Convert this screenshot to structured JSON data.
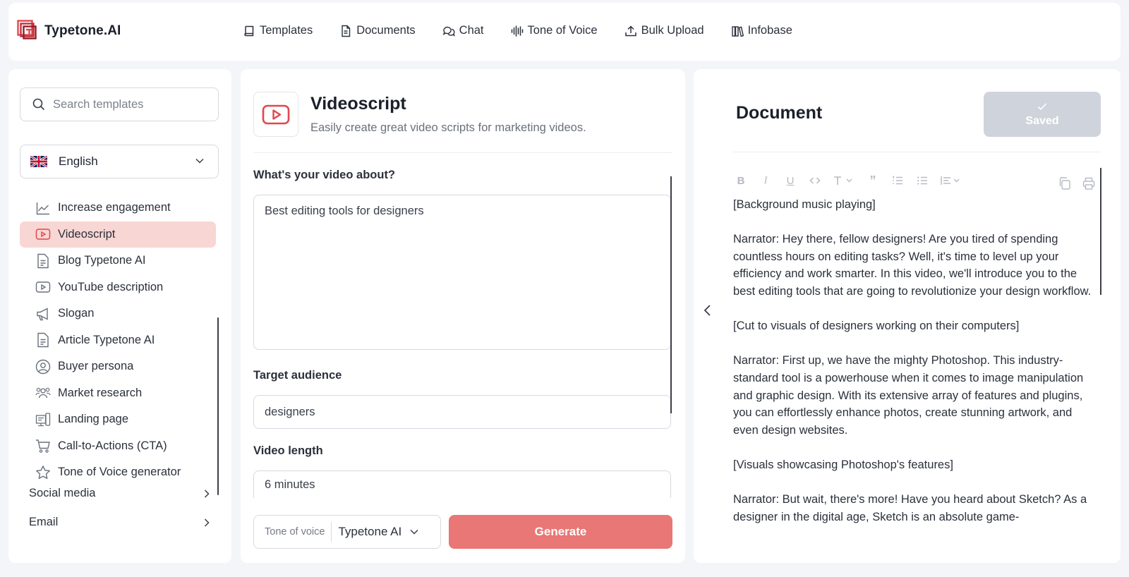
{
  "brand": {
    "name": "Typetone.AI"
  },
  "nav": [
    {
      "label": "Templates",
      "icon": "book-icon"
    },
    {
      "label": "Documents",
      "icon": "document-icon"
    },
    {
      "label": "Chat",
      "icon": "chat-icon"
    },
    {
      "label": "Tone of Voice",
      "icon": "soundwave-icon"
    },
    {
      "label": "Bulk Upload",
      "icon": "upload-icon"
    },
    {
      "label": "Infobase",
      "icon": "library-icon"
    }
  ],
  "sidebar": {
    "search_placeholder": "Search templates",
    "language": "English",
    "templates": [
      {
        "label": "Increase engagement",
        "icon": "trend-icon",
        "active": false
      },
      {
        "label": "Videoscript",
        "icon": "video-play-icon",
        "active": true
      },
      {
        "label": "Blog Typetone AI",
        "icon": "document-icon",
        "active": false
      },
      {
        "label": "YouTube description",
        "icon": "video-play-icon",
        "active": false
      },
      {
        "label": "Slogan",
        "icon": "megaphone-icon",
        "active": false
      },
      {
        "label": "Article Typetone AI",
        "icon": "document-icon",
        "active": false
      },
      {
        "label": "Buyer persona",
        "icon": "user-circle-icon",
        "active": false
      },
      {
        "label": "Market research",
        "icon": "users-icon",
        "active": false
      },
      {
        "label": "Landing page",
        "icon": "landing-page-icon",
        "active": false
      },
      {
        "label": "Call-to-Actions (CTA)",
        "icon": "cart-icon",
        "active": false
      },
      {
        "label": "Tone of Voice generator",
        "icon": "star-icon",
        "active": false
      }
    ],
    "categories": [
      {
        "label": "Social media"
      },
      {
        "label": "Email"
      }
    ]
  },
  "template": {
    "title": "Videoscript",
    "subtitle": "Easily create great video scripts for marketing videos.",
    "fields": {
      "topic_label": "What's your video about?",
      "topic_value": "Best editing tools for designers",
      "audience_label": "Target audience",
      "audience_value": "designers",
      "length_label": "Video length",
      "length_value": "6 minutes"
    },
    "tone_label": "Tone of voice",
    "tone_value": "Typetone AI",
    "generate_label": "Generate"
  },
  "document": {
    "title": "Document",
    "saved_label": "Saved",
    "toolbar": [
      "bold",
      "italic",
      "underline",
      "code",
      "text-style",
      "quote",
      "ordered-list",
      "bullet-list",
      "align"
    ],
    "paragraphs": [
      "[Background music playing]",
      "Narrator: Hey there, fellow designers! Are you tired of spending countless hours on editing tasks? Well, it's time to level up your efficiency and work smarter. In this video, we'll introduce you to the best editing tools that are going to revolutionize your design workflow.",
      "[Cut to visuals of designers working on their computers]",
      "Narrator: First up, we have the mighty Photoshop. This industry-standard tool is a powerhouse when it comes to image manipulation and graphic design. With its extensive array of features and plugins, you can effortlessly enhance photos, create stunning artwork, and even design websites.",
      "[Visuals showcasing Photoshop's features]",
      "Narrator: But wait, there's more! Have you heard about Sketch? As a designer in the digital age, Sketch is an absolute game-"
    ]
  },
  "colors": {
    "accent": "#e87775",
    "active_bg": "#f8d6d4",
    "saved_bg": "#cfd4dc"
  }
}
